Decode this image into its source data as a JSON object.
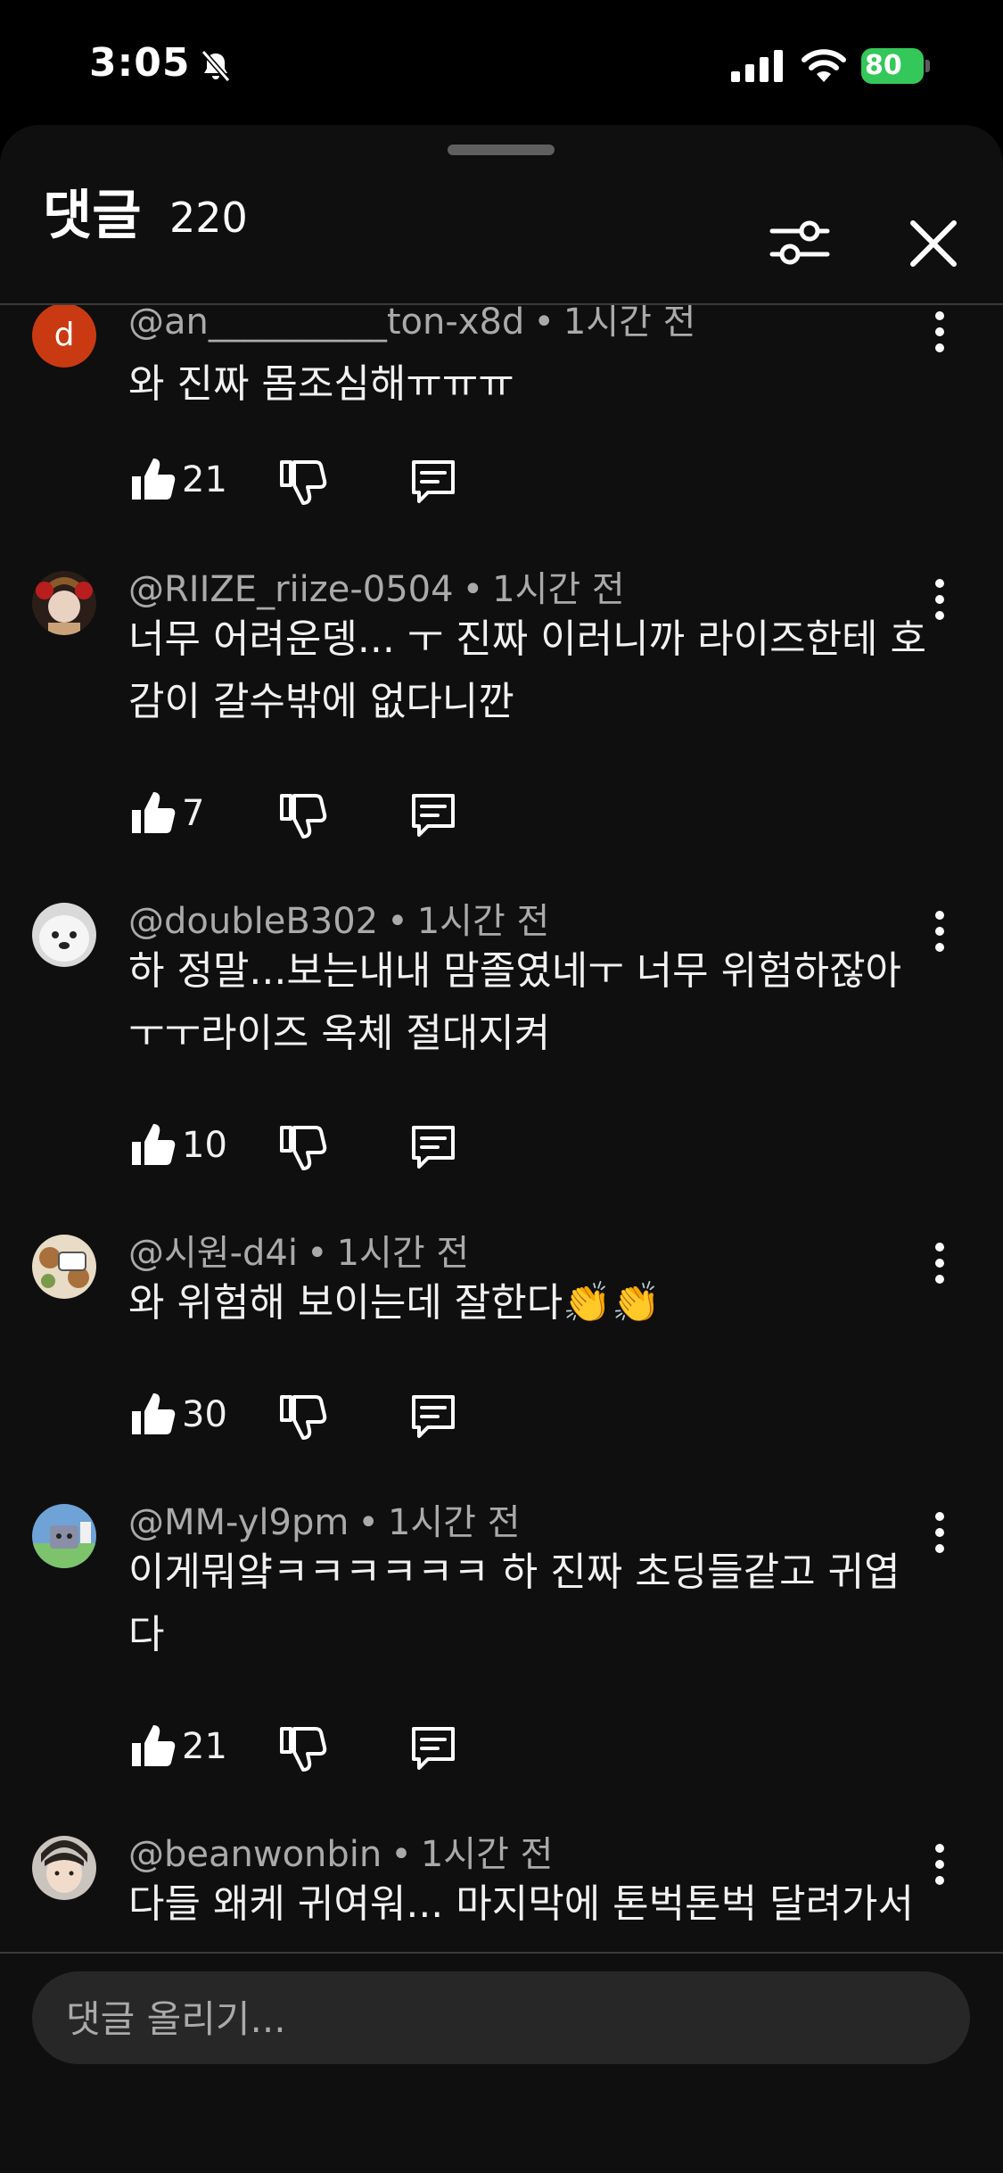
{
  "status_bar": {
    "time": "3:05",
    "battery": "80"
  },
  "sheet": {
    "title": "댓글",
    "count": "220"
  },
  "comments": [
    {
      "author": "@an__________ton-x8d",
      "time": "1시간 전",
      "text": "와 진짜 몸조심해ㅠㅠㅠ",
      "likes": "21",
      "avatar_letter": "d"
    },
    {
      "author": "@RIIZE_riize-0504",
      "time": "1시간 전",
      "text": "너무 어려운뎅... ㅜ 진짜 이러니까 라이즈한테 호감이 갈수밖에 없다니깐",
      "likes": "7"
    },
    {
      "author": "@doubleB302",
      "time": "1시간 전",
      "text": "하 정말...보는내내 맘졸였네ㅜ 너무 위험하잖아 ㅜㅜ라이즈 옥체 절대지켜",
      "likes": "10"
    },
    {
      "author": "@시원-d4i",
      "time": "1시간 전",
      "text": "와 위험해 보이는데 잘한다👏👏",
      "likes": "30"
    },
    {
      "author": "@MM-yl9pm",
      "time": "1시간 전",
      "text": "이게뭐얔ㅋㅋㅋㅋㅋㅋ 하 진짜 초딩들같고 귀엽다",
      "likes": "21"
    },
    {
      "author": "@beanwonbin",
      "time": "1시간 전",
      "text": "다들 왜케 귀여워... 마지막에 톤벅톤벅 달려가서"
    }
  ],
  "composer": {
    "placeholder": "댓글 올리기..."
  },
  "icons": {
    "filter": "sliders-icon",
    "close": "close-icon",
    "like": "thumbs-up-icon",
    "dislike": "thumbs-down-icon",
    "reply": "comment-icon",
    "more": "more-vertical-icon"
  },
  "colors": {
    "background": "#0f0f0f",
    "text_primary": "#f1f1f1",
    "text_secondary": "#aaaaaa",
    "battery": "#34c759"
  }
}
